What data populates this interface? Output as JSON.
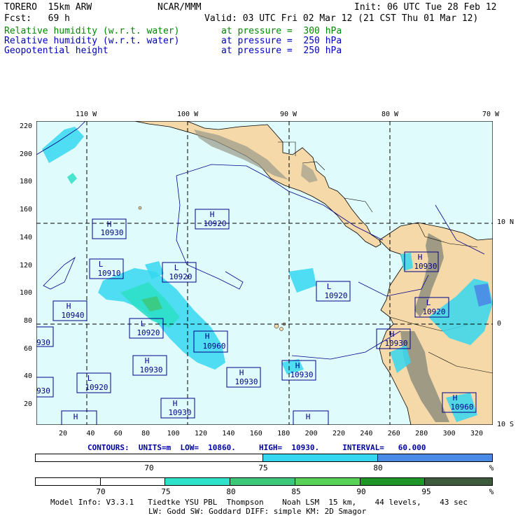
{
  "header": {
    "model": "TORERO  15km ARW",
    "org": "NCAR/MMM",
    "init": "Init: 06 UTC Tue 28 Feb 12",
    "fcst": "Fcst:   69 h",
    "valid": "Valid: 03 UTC Fri 02 Mar 12 (21 CST Thu 01 Mar 12)",
    "fields": [
      {
        "name": "Relative humidity (w.r.t. water)",
        "level": "at pressure =  300 hPa",
        "color": "#008800"
      },
      {
        "name": "Relative humidity (w.r.t. water)",
        "level": "at pressure =  250 hPa",
        "color": "#0000c0"
      },
      {
        "name": "Geopotential height",
        "level": "at pressure =  250 hPa",
        "color": "#0000c0"
      }
    ]
  },
  "map": {
    "top_lon_labels": [
      "110 W",
      "100 W",
      "90 W",
      "80 W",
      "70 W"
    ],
    "right_lat_labels": [
      "10 N",
      "0",
      "10 S"
    ],
    "left_ticks": [
      "220",
      "200",
      "180",
      "160",
      "140",
      "120",
      "100",
      "80",
      "60",
      "40",
      "20"
    ],
    "bottom_ticks": [
      "20",
      "40",
      "60",
      "80",
      "100",
      "120",
      "140",
      "160",
      "180",
      "200",
      "220",
      "240",
      "260",
      "280",
      "300",
      "320"
    ],
    "colors": {
      "ocean": "#dffbfb",
      "land": "#f5d9a9",
      "terrain": "#8a8a7a",
      "contour": "#00008b",
      "grid": "#000000"
    },
    "centers": [
      {
        "type": "H",
        "value": "10930"
      },
      {
        "type": "H",
        "value": "10920"
      },
      {
        "type": "L",
        "value": "10910"
      },
      {
        "type": "L",
        "value": "10920"
      },
      {
        "type": "H",
        "value": "10940"
      },
      {
        "type": "L",
        "value": "10920"
      },
      {
        "type": "H",
        "value": "10960"
      },
      {
        "type": "H",
        "value": "10930"
      },
      {
        "type": "H",
        "value": "10930"
      },
      {
        "type": "H",
        "value": "10930"
      },
      {
        "type": "L",
        "value": "10920"
      },
      {
        "type": "H",
        "value": "10930"
      },
      {
        "type": "H",
        "value": "10930"
      },
      {
        "type": "H",
        "value": "10930"
      },
      {
        "type": "L",
        "value": "10920"
      },
      {
        "type": "L",
        "value": "10920"
      },
      {
        "type": "H",
        "value": "10960"
      },
      {
        "type": "",
        "value": "930"
      },
      {
        "type": "",
        "value": "930"
      },
      {
        "type": "H",
        "value": ""
      },
      {
        "type": "H",
        "value": ""
      }
    ]
  },
  "contours_info": "CONTOURS:  UNITS=m  LOW=  10860.     HIGH=  10930.     INTERVAL=   60.000",
  "colorbar1": {
    "ticks": [
      "70",
      "75",
      "80"
    ],
    "unit": "%",
    "colors": [
      "#ffffff",
      "#35d7f0",
      "#4a8ae6"
    ]
  },
  "colorbar2": {
    "ticks": [
      "70",
      "75",
      "80",
      "85",
      "90",
      "95"
    ],
    "unit": "%",
    "colors": [
      "#ffffff",
      "#ffffff",
      "#2de0c8",
      "#3cc878",
      "#5ad25a",
      "#1e9628",
      "#2c5a2c",
      "#444444"
    ]
  },
  "footer": {
    "line1": "Model Info: V3.3.1   Tiedtke YSU PBL  Thompson    Noah LSM  15 km,    44 levels,    43 sec",
    "line2": "LW: Godd SW: Goddard DIFF: simple KM: 2D Smagor"
  }
}
